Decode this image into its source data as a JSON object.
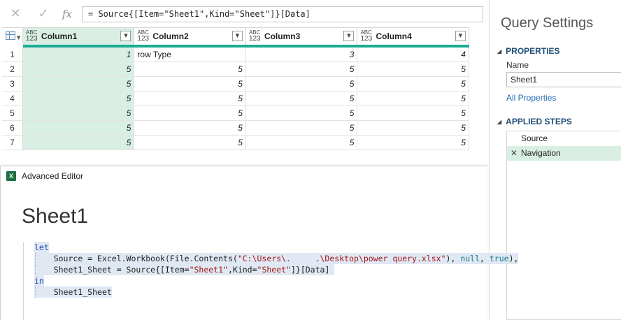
{
  "formula_bar": {
    "cancel_icon": "x-icon",
    "confirm_icon": "check-icon",
    "fx_label": "fx",
    "formula_prefix": "= Source[[Item=\"Sheet1\",Kind=\"Sheet\"]][Data]"
  },
  "grid": {
    "columns": [
      {
        "type_top": "ABC",
        "type_bottom": "123",
        "label": "Column1"
      },
      {
        "type_top": "ABC",
        "type_bottom": "123",
        "label": "Column2"
      },
      {
        "type_top": "ABC",
        "type_bottom": "123",
        "label": "Column3"
      },
      {
        "type_top": "ABC",
        "type_bottom": "123",
        "label": "Column4"
      }
    ],
    "rows": [
      {
        "num": "1",
        "cells": [
          "1",
          "row Type",
          "3",
          "4"
        ]
      },
      {
        "num": "2",
        "cells": [
          "5",
          "5",
          "5",
          "5"
        ]
      },
      {
        "num": "3",
        "cells": [
          "5",
          "5",
          "5",
          "5"
        ]
      },
      {
        "num": "4",
        "cells": [
          "5",
          "5",
          "5",
          "5"
        ]
      },
      {
        "num": "5",
        "cells": [
          "5",
          "5",
          "5",
          "5"
        ]
      },
      {
        "num": "6",
        "cells": [
          "5",
          "5",
          "5",
          "5"
        ]
      },
      {
        "num": "7",
        "cells": [
          "5",
          "5",
          "5",
          "5"
        ]
      }
    ],
    "filter_icon": "chevron-down-icon"
  },
  "settings": {
    "title": "Query Settings",
    "properties_header": "PROPERTIES",
    "name_label": "Name",
    "name_value": "Sheet1",
    "all_properties_link": "All Properties",
    "applied_steps_header": "APPLIED STEPS",
    "steps": [
      {
        "label": "Source",
        "active": false
      },
      {
        "label": "Navigation",
        "active": true
      }
    ]
  },
  "editor": {
    "window_title": "Advanced Editor",
    "app_icon": "excel-icon",
    "heading": "Sheet1",
    "code": {
      "line1_kw": "let",
      "line2_a": "Source = Excel.Workbook(File.Contents(",
      "line2_str": "\"C:\\Users\\.     .\\Desktop\\power query.xlsx\"",
      "line2_b": "), ",
      "line2_null": "null",
      "line2_c": ", ",
      "line2_true": "true",
      "line2_d": "),",
      "line3_a": "Sheet1_Sheet = Source{[Item=",
      "line3_str1": "\"Sheet1\"",
      "line3_b": ",Kind=",
      "line3_str2": "\"Sheet\"",
      "line3_c": "]}[Data]",
      "line4_kw": "in",
      "line5": "Sheet1_Sheet"
    }
  },
  "colors": {
    "selection_green": "#d9efe3",
    "quality_bar": "#1bab94",
    "section_header": "#1e4e79",
    "link": "#1f6ab4",
    "keyword": "#1f4fb0",
    "string": "#a31515"
  }
}
